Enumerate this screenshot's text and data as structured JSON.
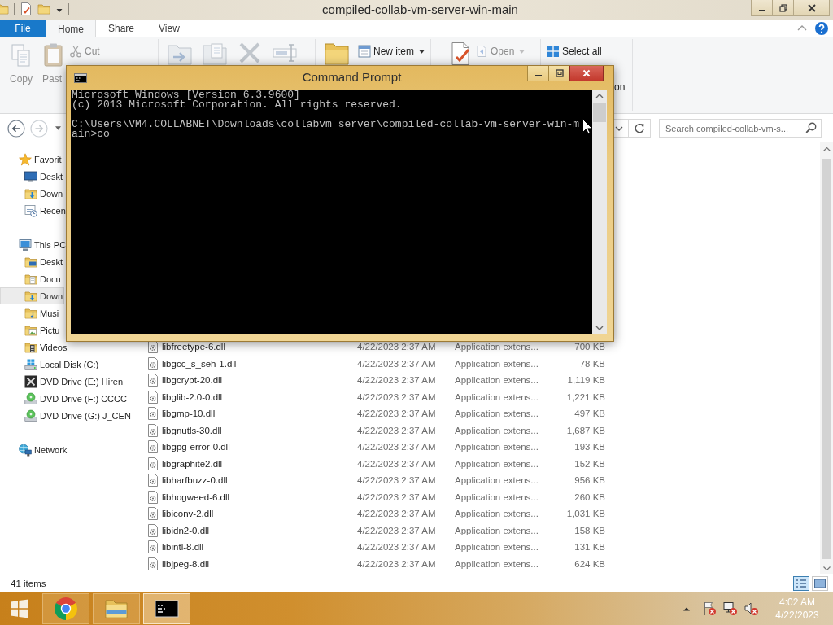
{
  "explorer": {
    "title": "compiled-collab-vm-server-win-main",
    "tabs": [
      {
        "label": "File",
        "kind": "menu",
        "selected": false
      },
      {
        "label": "Home",
        "kind": "tab",
        "selected": true
      },
      {
        "label": "Share",
        "kind": "tab",
        "selected": false
      },
      {
        "label": "View",
        "kind": "tab",
        "selected": false
      }
    ],
    "ribbon": {
      "clipboard": [
        {
          "label": "Copy",
          "disabled": true
        },
        {
          "label": "Past",
          "disabled": true
        },
        {
          "label": "Cut",
          "disabled": true
        }
      ],
      "new": [
        {
          "label": "New item",
          "disabled": false
        }
      ],
      "open": [
        {
          "label": "Open",
          "disabled": true
        }
      ],
      "select": [
        {
          "label": "Select all",
          "disabled": false
        },
        {
          "label": "on",
          "disabled": false
        }
      ]
    },
    "search": {
      "placeholder": "Search compiled-collab-vm-s..."
    },
    "nav": [
      {
        "label": "Favorit",
        "selected": false,
        "children": [
          {
            "label": "Deskt",
            "selected": false
          },
          {
            "label": "Down",
            "selected": false
          },
          {
            "label": "Recen",
            "selected": false
          }
        ]
      },
      {
        "label": "This PC",
        "selected": false,
        "children": [
          {
            "label": "Deskt",
            "selected": false
          },
          {
            "label": "Docu",
            "selected": false
          },
          {
            "label": "Down",
            "selected": true
          },
          {
            "label": "Musi",
            "selected": false
          },
          {
            "label": "Pictu",
            "selected": false
          },
          {
            "label": "Videos",
            "selected": false
          },
          {
            "label": "Local Disk (C:)",
            "selected": false
          },
          {
            "label": "DVD Drive (E:) Hiren",
            "selected": false
          },
          {
            "label": "DVD Drive (F:) CCCC",
            "selected": false
          },
          {
            "label": "DVD Drive (G:) J_CEN",
            "selected": false
          }
        ]
      },
      {
        "label": "Network",
        "selected": false
      }
    ],
    "files": [
      {
        "name": "libfreetype-6.dll",
        "modified": "4/22/2023 2:37 AM",
        "type": "Application extens...",
        "size": "700 KB",
        "selected": false
      },
      {
        "name": "libgcc_s_seh-1.dll",
        "modified": "4/22/2023 2:37 AM",
        "type": "Application extens...",
        "size": "78 KB",
        "selected": false
      },
      {
        "name": "libgcrypt-20.dll",
        "modified": "4/22/2023 2:37 AM",
        "type": "Application extens...",
        "size": "1,119 KB",
        "selected": false
      },
      {
        "name": "libglib-2.0-0.dll",
        "modified": "4/22/2023 2:37 AM",
        "type": "Application extens...",
        "size": "1,221 KB",
        "selected": false
      },
      {
        "name": "libgmp-10.dll",
        "modified": "4/22/2023 2:37 AM",
        "type": "Application extens...",
        "size": "497 KB",
        "selected": false
      },
      {
        "name": "libgnutls-30.dll",
        "modified": "4/22/2023 2:37 AM",
        "type": "Application extens...",
        "size": "1,687 KB",
        "selected": false
      },
      {
        "name": "libgpg-error-0.dll",
        "modified": "4/22/2023 2:37 AM",
        "type": "Application extens...",
        "size": "193 KB",
        "selected": false
      },
      {
        "name": "libgraphite2.dll",
        "modified": "4/22/2023 2:37 AM",
        "type": "Application extens...",
        "size": "152 KB",
        "selected": false
      },
      {
        "name": "libharfbuzz-0.dll",
        "modified": "4/22/2023 2:37 AM",
        "type": "Application extens...",
        "size": "956 KB",
        "selected": false
      },
      {
        "name": "libhogweed-6.dll",
        "modified": "4/22/2023 2:37 AM",
        "type": "Application extens...",
        "size": "260 KB",
        "selected": false
      },
      {
        "name": "libiconv-2.dll",
        "modified": "4/22/2023 2:37 AM",
        "type": "Application extens...",
        "size": "1,031 KB",
        "selected": false
      },
      {
        "name": "libidn2-0.dll",
        "modified": "4/22/2023 2:37 AM",
        "type": "Application extens...",
        "size": "158 KB",
        "selected": false
      },
      {
        "name": "libintl-8.dll",
        "modified": "4/22/2023 2:37 AM",
        "type": "Application extens...",
        "size": "131 KB",
        "selected": false
      },
      {
        "name": "libjpeg-8.dll",
        "modified": "4/22/2023 2:37 AM",
        "type": "Application extens...",
        "size": "624 KB",
        "selected": false
      }
    ],
    "status": {
      "count": "41 items",
      "views": [
        {
          "selected": true
        },
        {
          "selected": false
        }
      ]
    }
  },
  "console": {
    "title": "Command Prompt",
    "blocks": [
      [
        "Microsoft Windows [Version 6.3.9600]",
        "(c) 2013 Microsoft Corporation. All rights reserved."
      ],
      [
        "C:\\Users\\VM4.COLLABNET\\Downloads\\collabvm server\\compiled-collab-vm-server-win-main>co"
      ]
    ]
  },
  "taskbar": {
    "apps": [
      {
        "selected": false
      },
      {
        "selected": false
      },
      {
        "selected": true
      }
    ],
    "time": "4:02 AM",
    "date": "4/22/2023"
  }
}
